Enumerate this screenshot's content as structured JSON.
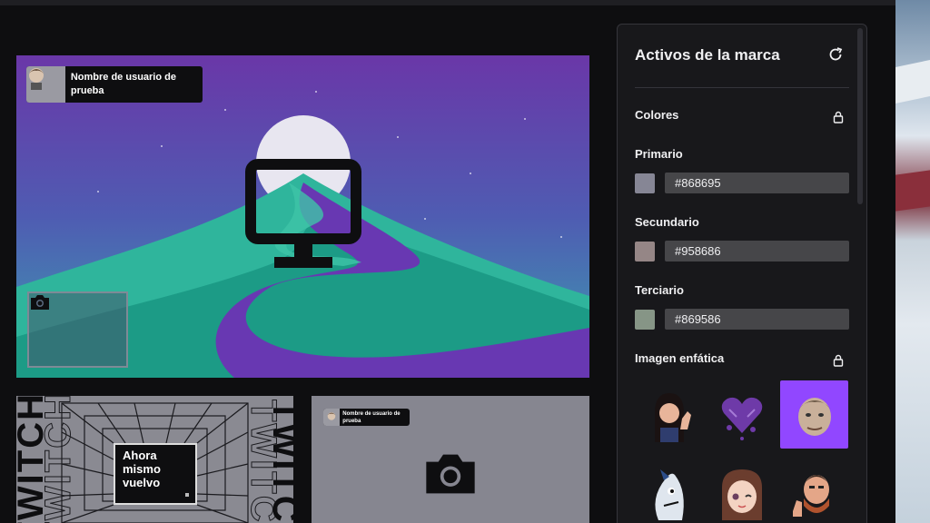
{
  "preview": {
    "username": "Nombre de usuario de prueba",
    "brb_text": "Ahora mismo vuelvo",
    "twitch_word": "TWITCH",
    "twitch_partial": "TWITC"
  },
  "panel": {
    "title": "Activos de la marca",
    "colors_label": "Colores",
    "colors": [
      {
        "label": "Primario",
        "hex": "#868695"
      },
      {
        "label": "Secundario",
        "hex": "#958686"
      },
      {
        "label": "Terciario",
        "hex": "#869586"
      }
    ],
    "emphasis_label": "Imagen enfática",
    "emotes": [
      "woman-waving-emote",
      "purple-heart-emote",
      "kappa-face-emote",
      "fish-emote",
      "anime-girl-emote",
      "thumbs-up-man-emote"
    ]
  },
  "theme": {
    "accent": "#9147ff",
    "panel_bg": "#18181b",
    "page_bg": "#0e0e10"
  }
}
